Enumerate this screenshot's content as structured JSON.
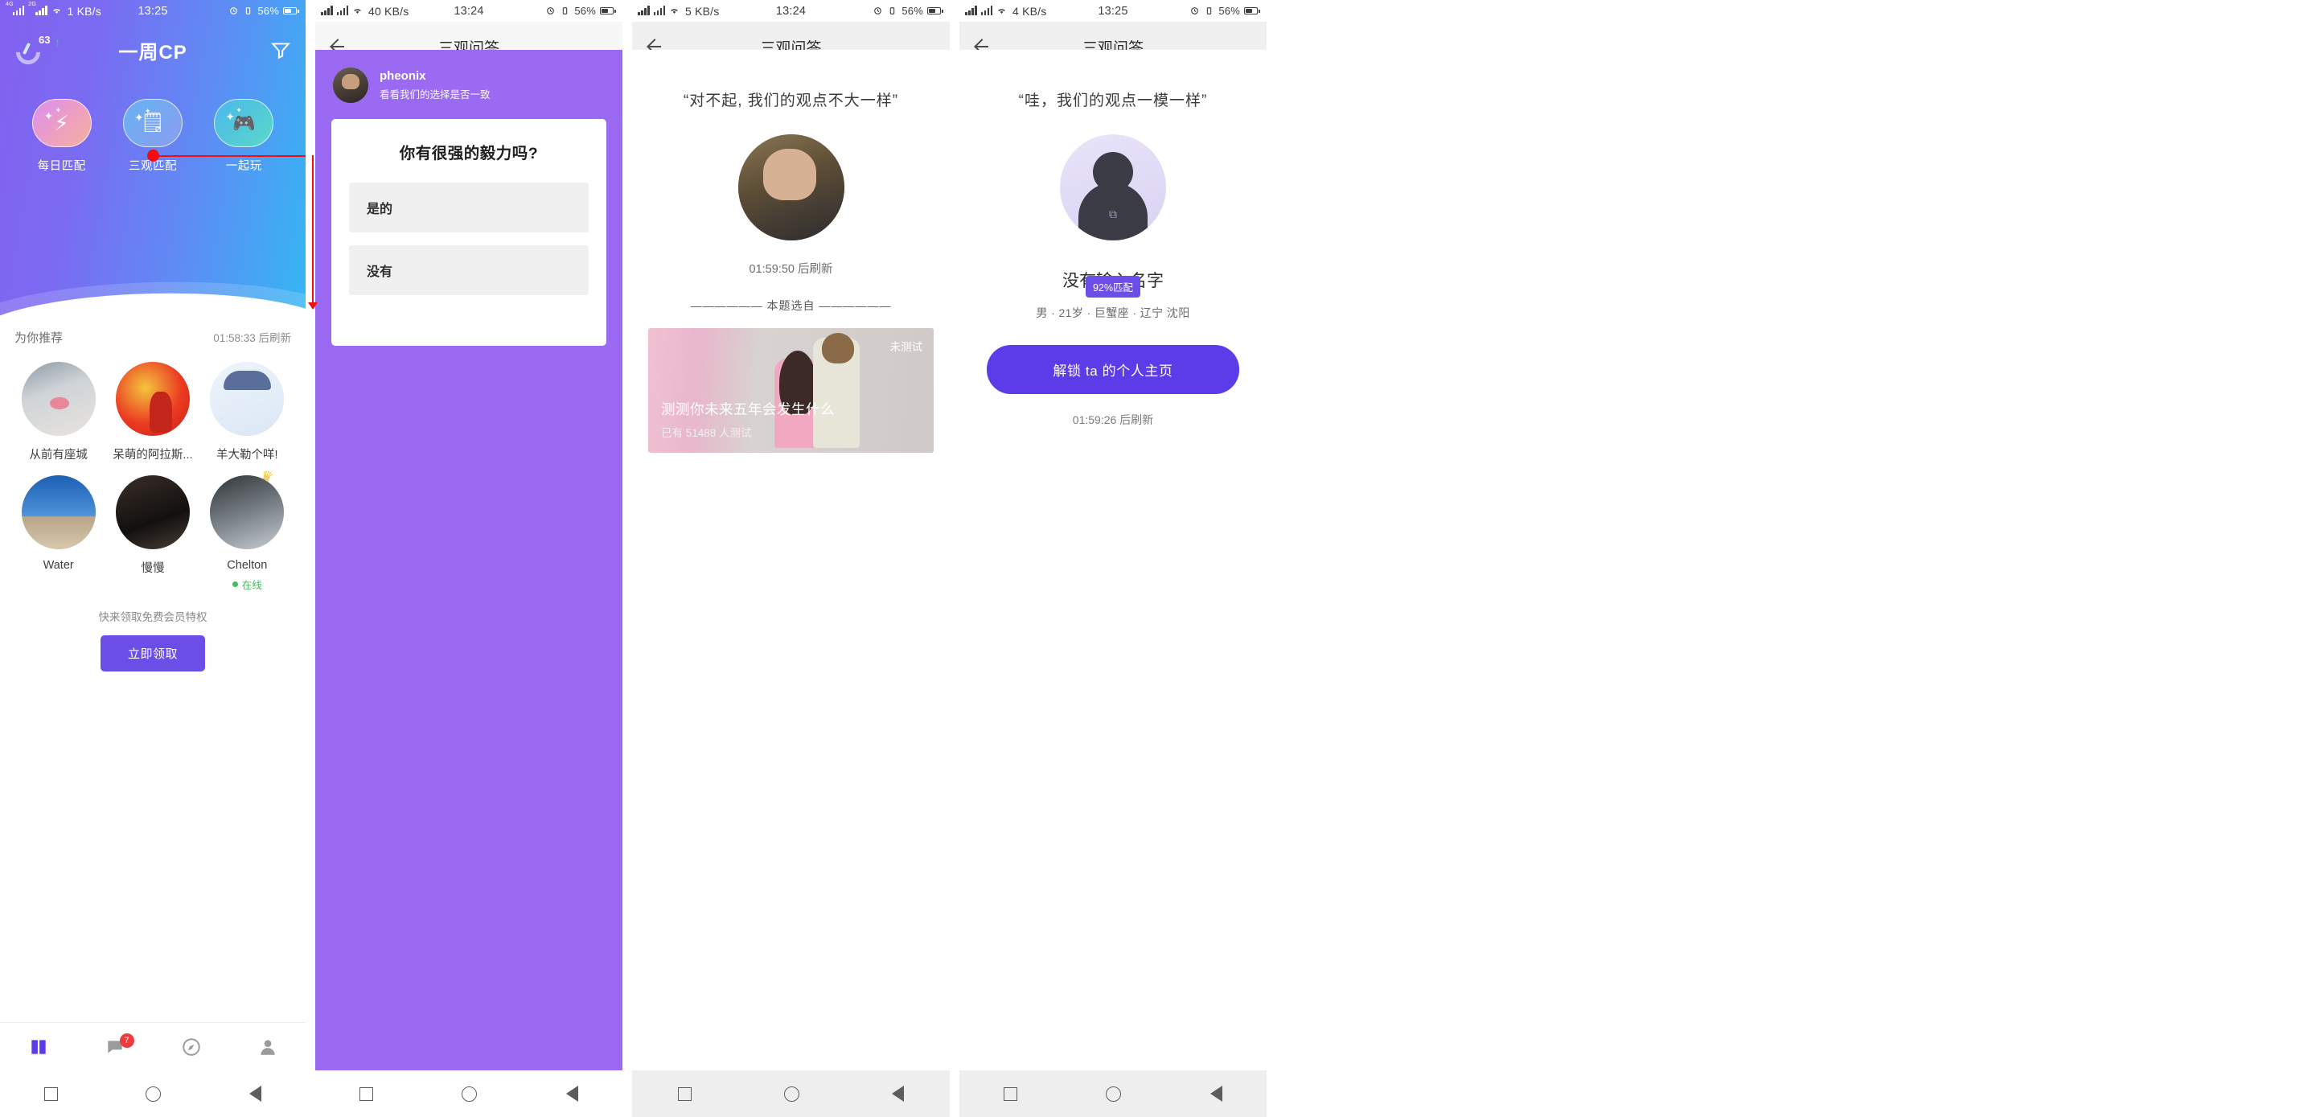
{
  "panels": [
    {
      "status": {
        "net1": "4G",
        "net2": "2G",
        "wifi": "wifi-icon",
        "speed": "1 KB/s",
        "time": "13:25",
        "alarm": "alarm-icon",
        "vibrate": "vibrate-icon",
        "battery": "56%"
      },
      "header": {
        "score": "63",
        "arrow": "↑",
        "title": "一周CP",
        "filter_icon": "funnel-icon"
      },
      "tabs": [
        {
          "label": "每日匹配",
          "icon": "lightning-people-icon"
        },
        {
          "label": "三观匹配",
          "icon": "checklist-icon"
        },
        {
          "label": "一起玩",
          "icon": "gamepad-icon"
        }
      ],
      "recommend": {
        "title": "为你推荐",
        "refresh": "01:58:33 后刷新"
      },
      "people": [
        {
          "name": "从前有座城",
          "status": ""
        },
        {
          "name": "呆萌的阿拉斯...",
          "status": ""
        },
        {
          "name": "羊大勒个咩!",
          "status": ""
        },
        {
          "name": "Water",
          "status": ""
        },
        {
          "name": "慢慢",
          "status": ""
        },
        {
          "name": "Chelton",
          "status": "在线",
          "crown": "crown-icon"
        }
      ],
      "promo": {
        "text": "快来领取免费会员特权",
        "button": "立即领取"
      },
      "tabbar": [
        {
          "icon": "book-icon",
          "badge": ""
        },
        {
          "icon": "chat-icon",
          "badge": "7"
        },
        {
          "icon": "compass-icon",
          "badge": ""
        },
        {
          "icon": "person-icon",
          "badge": ""
        }
      ]
    },
    {
      "status": {
        "net1": "",
        "net2": "",
        "wifi": "wifi-icon",
        "speed": "40 KB/s",
        "time": "13:24",
        "alarm": "alarm-icon",
        "vibrate": "vibrate-icon",
        "battery": "56%"
      },
      "header": {
        "back": "back-arrow-icon",
        "title": "三观问答"
      },
      "user": {
        "name": "pheonix",
        "sub": "看看我们的选择是否一致"
      },
      "question": {
        "title": "你有很强的毅力吗?",
        "options": [
          "是的",
          "没有"
        ]
      }
    },
    {
      "status": {
        "net1": "",
        "net2": "",
        "wifi": "wifi-icon",
        "speed": "5 KB/s",
        "time": "13:24",
        "alarm": "alarm-icon",
        "vibrate": "vibrate-icon",
        "battery": "56%"
      },
      "header": {
        "back": "back-arrow-icon",
        "title": "三观问答"
      },
      "result": {
        "title": "“对不起, 我们的观点不大一样”",
        "refresh": "01:59:50 后刷新",
        "from": "—————— 本题选自 ——————"
      },
      "banner": {
        "tag": "未测试",
        "title": "测测你未来五年会发生什么",
        "sub": "已有 51488 人测试"
      }
    },
    {
      "status": {
        "net1": "",
        "net2": "",
        "wifi": "wifi-icon",
        "speed": "4 KB/s",
        "time": "13:25",
        "alarm": "alarm-icon",
        "vibrate": "vibrate-icon",
        "battery": "56%"
      },
      "header": {
        "back": "back-arrow-icon",
        "title": "三观问答"
      },
      "match": {
        "title": "“哇，我们的观点一模一样”",
        "badge": "92%匹配",
        "name": "没有输入名字",
        "meta": "男 · 21岁 · 巨蟹座 · 辽宁 沈阳",
        "button": "解锁 ta 的个人主页",
        "refresh": "01:59:26 后刷新"
      }
    }
  ],
  "nav": {
    "recent": "square-icon",
    "home": "circle-icon",
    "back": "triangle-back-icon"
  },
  "colors": {
    "brand": "#6b4de8",
    "accent": "#5b3ce8",
    "online": "#3fbf5a",
    "badge": "#ef3b3b",
    "annotation": "#f50d0d"
  }
}
